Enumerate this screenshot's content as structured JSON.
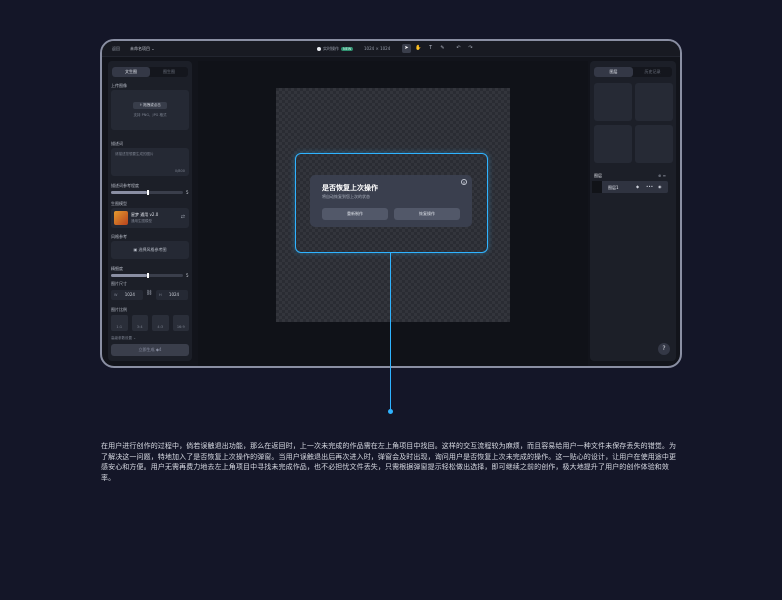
{
  "topbar": {
    "back": "返回",
    "project_name": "未命名项目",
    "live_label": "实时操作",
    "live_badge": "NEW",
    "size": "1024 × 1024",
    "tools": [
      "cursor-icon",
      "hand-icon",
      "text-icon",
      "brush-icon",
      "undo-icon",
      "redo-icon"
    ]
  },
  "left_panel": {
    "tabs": [
      "文生图",
      "图生图"
    ],
    "upload_label": "上传图像",
    "upload_button": "拖拽或点击",
    "upload_hint": "支持 PNG、JPG 格式",
    "prompt_label": "描述词",
    "prompt_placeholder": "请描述您想要生成的图片",
    "prompt_count": "0/800",
    "ref_strength_label": "描述词参考程度",
    "ref_strength_value": "5",
    "model_label": "生图模型",
    "model_name": "星梦 通用 v2.0",
    "model_desc": "通用生图模型",
    "style_label": "风格参考",
    "style_button": "选择风格参考图",
    "detail_label": "精细度",
    "detail_value": "5",
    "size_label": "图片尺寸",
    "width_prefix": "W",
    "width": "1024",
    "height_prefix": "H",
    "height": "1024",
    "ratio_label": "图片比例",
    "ratios": [
      "1:1",
      "3:4",
      "4:3",
      "16:9"
    ],
    "advanced_label": "高级参数设置",
    "generate_button": "立即生成",
    "generate_cost": "4"
  },
  "right_panel": {
    "tabs": [
      "图层",
      "历史记录"
    ],
    "layers_label": "图层",
    "layer_name": "图层1"
  },
  "dialog": {
    "title": "是否恢复上次操作",
    "subtitle": "将自动恢复到您上次的状态",
    "secondary": "重新制作",
    "primary": "恢复操作"
  },
  "help": "?",
  "description": "在用户进行创作的过程中，倘若误触退出功能，那么在返回时，上一次未完成的作品需在左上角项目中找回。这样的交互流程较为麻烦，而且容易给用户一种文件未保存丢失的错觉。为了解决这一问题，特地加入了是否恢复上次操作的弹窗。当用户误触退出后再次进入时，弹窗会及时出现，询问用户是否恢复上次未完成的操作。这一贴心的设计，让用户在使用途中更感安心和方便。用户无需再费力地去左上角项目中寻找未完成作品，也不必担忧文件丢失，只需根据弹窗提示轻松做出选择，即可继续之前的创作，极大地提升了用户的创作体验和效率。",
  "colors": {
    "accent": "#2fb3ff",
    "bg": "#141628",
    "panel": "#1c1f28"
  }
}
